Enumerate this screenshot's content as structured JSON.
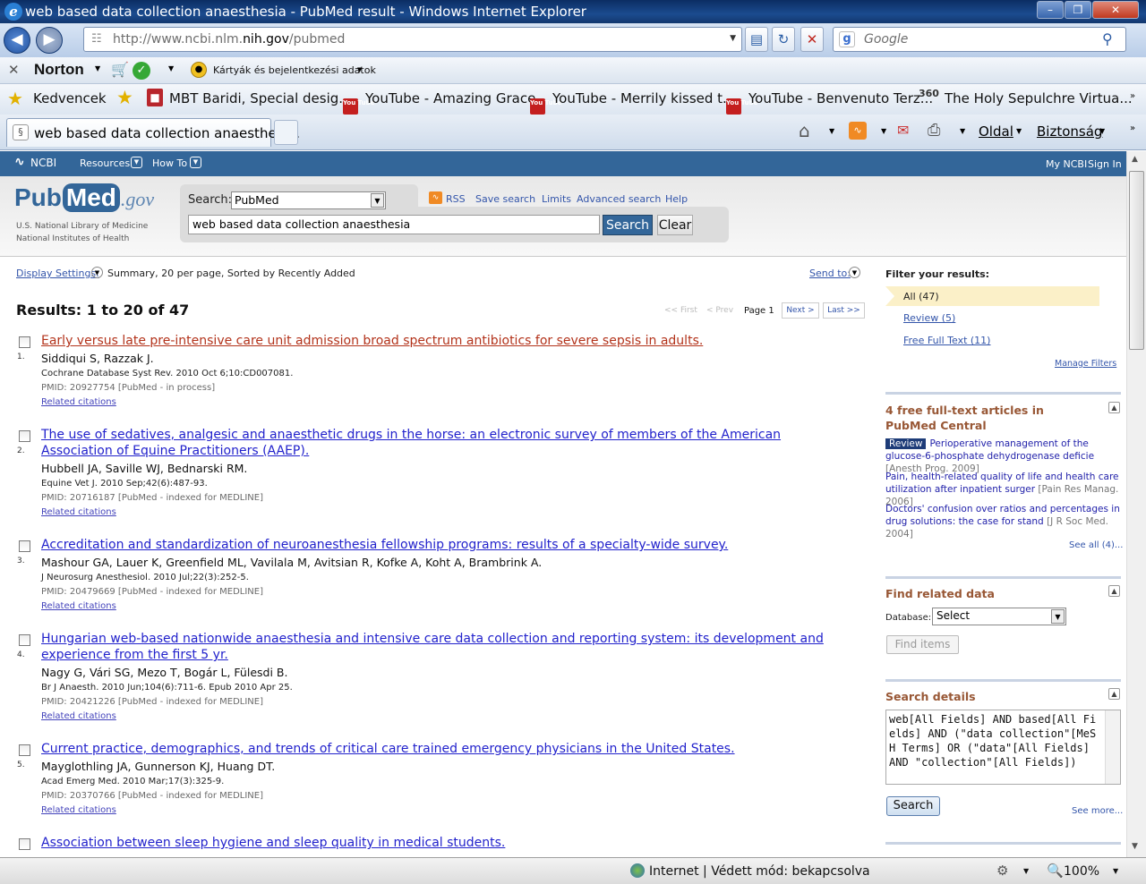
{
  "window": {
    "title": "web based data collection anaesthesia - PubMed result - Windows Internet Explorer",
    "min": "–",
    "max": "❒",
    "close": "✕"
  },
  "nav": {
    "url_prefix": "http://www.ncbi.nlm.",
    "url_domain": "nih.gov",
    "url_suffix": "/pubmed",
    "search_placeholder": "Google"
  },
  "norton": {
    "brand": "Norton",
    "cards": "Kártyák és bejelentkezési adatok"
  },
  "favorites": {
    "label": "Kedvencek",
    "items": [
      "MBT Baridi, Special desig...",
      "YouTube - Amazing Grace",
      "YouTube - Merrily kissed t...",
      "YouTube - Benvenuto Terz...",
      "The Holy Sepulchre Virtua..."
    ]
  },
  "tab": {
    "label": "web based data collection anaesthesi..."
  },
  "commands": {
    "page": "Oldal",
    "safety": "Biztonság"
  },
  "ncbi": {
    "logo": "NCBI",
    "resources": "Resources",
    "howto": "How To",
    "myncbi": "My NCBI",
    "signin": "Sign In"
  },
  "masthead": {
    "logo_pub": "Pub",
    "logo_med": "Med",
    "logo_gov": ".gov",
    "nlm": "U.S. National Library of Medicine",
    "nih": "National Institutes of Health",
    "search_label": "Search:",
    "db": "PubMed",
    "query": "web based data collection anaesthesia",
    "search_btn": "Search",
    "clear_btn": "Clear",
    "links": [
      "RSS",
      "Save search",
      "Limits",
      "Advanced search",
      "Help"
    ]
  },
  "display": {
    "settings_label": "Display Settings:",
    "settings_value": "Summary, 20 per page, Sorted by Recently Added",
    "send_to": "Send to:"
  },
  "results": {
    "heading": "Results: 1 to 20 of 47",
    "pager": {
      "first": "<< First",
      "prev": "< Prev",
      "page": "Page 1",
      "next": "Next >",
      "last": "Last >>"
    },
    "items": [
      {
        "num": "1.",
        "title": "Early versus late pre-intensive care unit admission broad spectrum antibiotics for severe sepsis in adults.",
        "authors": "Siddiqui S, Razzak J.",
        "source": "Cochrane Database Syst Rev. 2010 Oct 6;10:CD007081.",
        "pmid": "PMID: 20927754 [PubMed - in process]",
        "related": "Related citations"
      },
      {
        "num": "2.",
        "title": "The use of sedatives, analgesic and anaesthetic drugs in the horse: an electronic survey of members of the American Association of Equine Practitioners (AAEP).",
        "authors": "Hubbell JA, Saville WJ, Bednarski RM.",
        "source": "Equine Vet J. 2010 Sep;42(6):487-93.",
        "pmid": "PMID: 20716187 [PubMed - indexed for MEDLINE]",
        "related": "Related citations"
      },
      {
        "num": "3.",
        "title": "Accreditation and standardization of neuroanesthesia fellowship programs: results of a specialty-wide survey.",
        "authors": "Mashour GA, Lauer K, Greenfield ML, Vavilala M, Avitsian R, Kofke A, Koht A, Brambrink A.",
        "source": "J Neurosurg Anesthesiol. 2010 Jul;22(3):252-5.",
        "pmid": "PMID: 20479669 [PubMed - indexed for MEDLINE]",
        "related": "Related citations"
      },
      {
        "num": "4.",
        "title": "Hungarian web-based nationwide anaesthesia and intensive care data collection and reporting system: its development and experience from the first 5 yr.",
        "authors": "Nagy G, Vári SG, Mezo T, Bogár L, Fülesdi B.",
        "source": "Br J Anaesth. 2010 Jun;104(6):711-6. Epub 2010 Apr 25.",
        "pmid": "PMID: 20421226 [PubMed - indexed for MEDLINE]",
        "related": "Related citations"
      },
      {
        "num": "5.",
        "title": "Current practice, demographics, and trends of critical care trained emergency physicians in the United States.",
        "authors": "Mayglothling JA, Gunnerson KJ, Huang DT.",
        "source": "Acad Emerg Med. 2010 Mar;17(3):325-9.",
        "pmid": "PMID: 20370766 [PubMed - indexed for MEDLINE]",
        "related": "Related citations"
      },
      {
        "num": "",
        "title": "Association between sleep hygiene and sleep quality in medical students.",
        "authors": "",
        "source": "",
        "pmid": "",
        "related": ""
      }
    ]
  },
  "filter": {
    "heading": "Filter your results:",
    "items": [
      "All (47)",
      "Review (5)",
      "Free Full Text (11)"
    ],
    "manage": "Manage Filters"
  },
  "freetext": {
    "heading": "4 free full-text articles in PubMed Central",
    "review_badge": "Review",
    "items": [
      {
        "text": "Perioperative management of the glucose-6-phosphate dehydrogenase deficie",
        "src": "[Anesth Prog. 2009]"
      },
      {
        "text": "Pain, health-related quality of life and health care utilization after inpatient surger",
        "src": "[Pain Res Manag. 2006]"
      },
      {
        "text": "Doctors' confusion over ratios and percentages in drug solutions: the case for stand",
        "src": "[J R Soc Med. 2004]"
      }
    ],
    "see_all": "See all (4)..."
  },
  "related": {
    "heading": "Find related data",
    "db_label": "Database:",
    "db_value": "Select",
    "find_btn": "Find items"
  },
  "details": {
    "heading": "Search details",
    "query": "web[All Fields] AND based[All Fields] AND (\"data collection\"[MeSH Terms] OR (\"data\"[All Fields] AND \"collection\"[All Fields])",
    "search_btn": "Search",
    "see_more": "See more..."
  },
  "status": {
    "zone": "Internet | Védett mód: bekapcsolva",
    "zoom": "100%"
  }
}
